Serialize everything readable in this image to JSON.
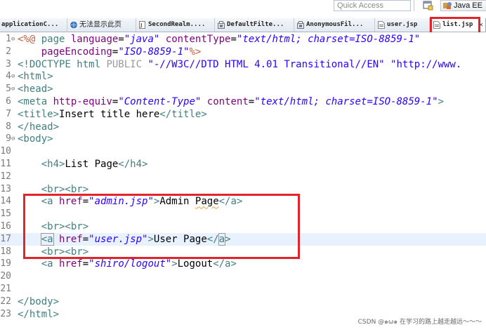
{
  "toolbar": {
    "quick_access_placeholder": "Quick Access",
    "perspective_label": "Java EE"
  },
  "tabs": [
    {
      "label": "applicationC...",
      "icon": "none",
      "active": false
    },
    {
      "label": "无法显示此页",
      "icon": "globe-icon",
      "active": false
    },
    {
      "label": "SecondRealm....",
      "icon": "java-file-icon",
      "active": false
    },
    {
      "label": "DefaultFilte...",
      "icon": "class-file-icon",
      "active": false
    },
    {
      "label": "AnonymousFil...",
      "icon": "class-file-icon",
      "active": false
    },
    {
      "label": "user.jsp",
      "icon": "jsp-file-icon",
      "active": false
    },
    {
      "label": "list.jsp",
      "icon": "jsp-file-icon",
      "active": true,
      "close": "✕"
    }
  ],
  "editor": {
    "lines": [
      {
        "n": "1",
        "fold": "⊖",
        "segs": [
          [
            "dir",
            "<%@ "
          ],
          [
            "kw",
            "page "
          ],
          [
            "at",
            "language"
          ],
          [
            "txt",
            "="
          ],
          [
            "val",
            "\"java\""
          ],
          [
            "txt",
            " "
          ],
          [
            "at",
            "contentType"
          ],
          [
            "txt",
            "="
          ],
          [
            "val",
            "\"text/html; charset=ISO-8859-1\""
          ]
        ]
      },
      {
        "n": "2",
        "fold": "",
        "segs": [
          [
            "txt",
            "    "
          ],
          [
            "at",
            "pageEncoding"
          ],
          [
            "txt",
            "="
          ],
          [
            "val",
            "\"ISO-8859-1\""
          ],
          [
            "dir",
            "%>"
          ]
        ]
      },
      {
        "n": "3",
        "fold": "",
        "segs": [
          [
            "doc",
            "<!DOCTYPE html "
          ],
          [
            "pub",
            "PUBLIC"
          ],
          [
            "doc",
            " "
          ],
          [
            "str",
            "\"-//W3C//DTD HTML 4.01 Transitional//EN\""
          ],
          [
            "doc",
            " "
          ],
          [
            "str",
            "\"http://www."
          ]
        ]
      },
      {
        "n": "4",
        "fold": "⊖",
        "segs": [
          [
            "kw",
            "<html>"
          ]
        ]
      },
      {
        "n": "5",
        "fold": "⊖",
        "segs": [
          [
            "kw",
            "<head>"
          ]
        ]
      },
      {
        "n": "6",
        "fold": "",
        "segs": [
          [
            "kw",
            "<meta "
          ],
          [
            "at",
            "http-equiv"
          ],
          [
            "txt",
            "="
          ],
          [
            "val",
            "\"Content-Type\""
          ],
          [
            "txt",
            " "
          ],
          [
            "at",
            "content"
          ],
          [
            "txt",
            "="
          ],
          [
            "val",
            "\"text/html; charset=ISO-8859-1\""
          ],
          [
            "kw",
            ">"
          ]
        ]
      },
      {
        "n": "7",
        "fold": "",
        "segs": [
          [
            "kw",
            "<title>"
          ],
          [
            "txt",
            "Insert title here"
          ],
          [
            "kw",
            "</title>"
          ]
        ]
      },
      {
        "n": "8",
        "fold": "",
        "segs": [
          [
            "kw",
            "</head>"
          ]
        ]
      },
      {
        "n": "9",
        "fold": "⊖",
        "segs": [
          [
            "kw",
            "<body>"
          ]
        ]
      },
      {
        "n": "10",
        "fold": "",
        "segs": []
      },
      {
        "n": "11",
        "fold": "",
        "segs": [
          [
            "txt",
            "    "
          ],
          [
            "kw",
            "<h4>"
          ],
          [
            "txt",
            "List Page"
          ],
          [
            "kw",
            "</h4>"
          ]
        ]
      },
      {
        "n": "12",
        "fold": "",
        "segs": []
      },
      {
        "n": "13",
        "fold": "",
        "segs": [
          [
            "txt",
            "    "
          ],
          [
            "kw",
            "<br><br>"
          ]
        ]
      },
      {
        "n": "14",
        "fold": "",
        "segs": [
          [
            "txt",
            "    "
          ],
          [
            "kw",
            "<a "
          ],
          [
            "at",
            "href"
          ],
          [
            "txt",
            "="
          ],
          [
            "val",
            "\"admin.jsp\""
          ],
          [
            "kw",
            ">"
          ],
          [
            "txt",
            "Admin "
          ],
          [
            "spell",
            "Page"
          ],
          [
            "kw",
            "</a>"
          ]
        ]
      },
      {
        "n": "15",
        "fold": "",
        "segs": []
      },
      {
        "n": "16",
        "fold": "",
        "segs": [
          [
            "txt",
            "    "
          ],
          [
            "kw",
            "<br><br>"
          ]
        ]
      },
      {
        "n": "17",
        "fold": "",
        "current": true,
        "segs": [
          [
            "txt",
            "    "
          ],
          [
            "kwm",
            "<a"
          ],
          [
            "kw",
            " "
          ],
          [
            "at",
            "href"
          ],
          [
            "txt",
            "="
          ],
          [
            "val",
            "\"user.jsp\""
          ],
          [
            "kw",
            ">"
          ],
          [
            "txt",
            "User Page"
          ],
          [
            "kw",
            "</"
          ],
          [
            "kwm",
            "a"
          ],
          [
            "kw",
            ">"
          ]
        ]
      },
      {
        "n": "18",
        "fold": "",
        "segs": [
          [
            "txt",
            "    "
          ],
          [
            "kw",
            "<br><br>"
          ]
        ]
      },
      {
        "n": "19",
        "fold": "",
        "segs": [
          [
            "txt",
            "    "
          ],
          [
            "kw",
            "<a "
          ],
          [
            "at",
            "href"
          ],
          [
            "txt",
            "="
          ],
          [
            "val",
            "\"shiro/logout\""
          ],
          [
            "kw",
            ">"
          ],
          [
            "txt",
            "Logout"
          ],
          [
            "kw",
            "</a>"
          ]
        ]
      },
      {
        "n": "20",
        "fold": "",
        "segs": []
      },
      {
        "n": "21",
        "fold": "",
        "segs": []
      },
      {
        "n": "22",
        "fold": "",
        "segs": [
          [
            "kw",
            "</body>"
          ]
        ]
      },
      {
        "n": "23",
        "fold": "",
        "segs": [
          [
            "kw",
            "</html>"
          ]
        ]
      }
    ]
  },
  "watermark": "CSDN @๑ω๑ 在学习的路上越走越远～～～",
  "colors": {
    "annotation_red": "#e0262b",
    "current_line": "#e8f2fe"
  }
}
